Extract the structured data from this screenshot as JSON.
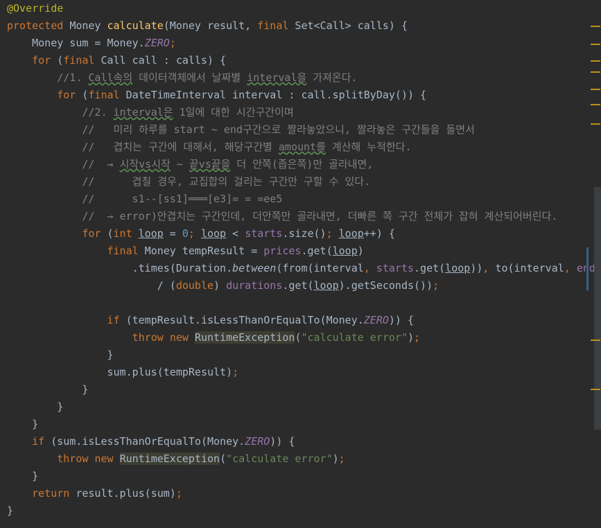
{
  "code": {
    "l01_annotation": "@Override",
    "l02_protected": "protected",
    "l02_type": "Money",
    "l02_method": "calculate",
    "l02_params_a": "(Money result, ",
    "l02_final": "final",
    "l02_params_b": " Set<Call> calls) {",
    "l03_a": "Money sum = Money.",
    "l03_zero": "ZERO",
    "l03_semi": ";",
    "l04_for": "for",
    "l04_a": " (",
    "l04_final": "final",
    "l04_b": " Call call : calls) {",
    "l05_comment_a": "//1. ",
    "l05_comment_b": "Call속의",
    "l05_comment_c": " 데이터객체에서 날짜별 ",
    "l05_comment_d": "interval을",
    "l05_comment_e": " 가져온다.",
    "l06_for": "for",
    "l06_a": " (",
    "l06_final": "final",
    "l06_b": " DateTimeInterval interval : call.splitByDay()) {",
    "l07_a": "//2. ",
    "l07_b": "interval은",
    "l07_c": " 1일에 대한 시간구간이며",
    "l08": "//   미리 하루를 start ~ end구간으로 짤라놓았으니, 짤라놓은 구간들을 돌면서",
    "l08_end": "end구간으로",
    "l09_a": "//   겹치는 구간에 대해서, 해당구간별 ",
    "l09_b": "amount를",
    "l09_c": " 계산해 누적한다.",
    "l10_a": "//  → ",
    "l10_b": "시작vs시작",
    "l10_c": " ~ ",
    "l10_d": "끝vs끝을",
    "l10_e": " 더 안쪽(좁은쪽)만 골라내면,",
    "l11": "//      겹칠 경우, 교집합의 걸리는 구간만 구할 수 있다.",
    "l12": "//      s1--[ss1]═══[e3]= = =ee5",
    "l13": "//  → error)안겹치는 구간인데, 더안쪽만 골라내면, 더빠른 쪽 구간 전체가 잡혀 계산되어버린다.",
    "l14_for": "for",
    "l14_a": " (",
    "l14_int": "int",
    "l14_loop1": "loop",
    "l14_eq": " = ",
    "l14_zero": "0",
    "l14_semi1": "; ",
    "l14_loop2": "loop",
    "l14_lt": " < ",
    "l14_starts": "starts",
    "l14_size": ".size()",
    "l14_semi2": "; ",
    "l14_loop3": "loop",
    "l14_inc": "++) {",
    "l15_final": "final",
    "l15_a": " Money tempResult = ",
    "l15_prices": "prices",
    "l15_b": ".get(",
    "l15_loop": "loop",
    "l15_c": ")",
    "l16_a": ".times(Duration.",
    "l16_between": "between",
    "l16_b": "(from(interval",
    "l16_comma1": ", ",
    "l16_starts": "starts",
    "l16_c": ".get(",
    "l16_loop": "loop",
    "l16_d": "))",
    "l16_comma2": ", ",
    "l16_e": "to(interval",
    "l16_comma3": ", ",
    "l16_ends": "ends",
    "l17_a": "/ (",
    "l17_double": "double",
    "l17_b": ") ",
    "l17_durations": "durations",
    "l17_c": ".get(",
    "l17_loop": "loop",
    "l17_d": ").getSeconds())",
    "l17_semi": ";",
    "l19_if": "if",
    "l19_a": " (tempResult.isLessThanOrEqualTo(Money.",
    "l19_zero": "ZERO",
    "l19_b": ")) {",
    "l20_throw": "throw",
    "l20_new": "new",
    "l20_exc": "RuntimeException",
    "l20_a": "(",
    "l20_str": "\"calculate error\"",
    "l20_b": ")",
    "l20_semi": ";",
    "l21": "}",
    "l22_a": "sum.plus(tempResult)",
    "l22_semi": ";",
    "l23": "}",
    "l24": "}",
    "l25": "}",
    "l26_if": "if",
    "l26_a": " (sum.isLessThanOrEqualTo(Money.",
    "l26_zero": "ZERO",
    "l26_b": ")) {",
    "l27_throw": "throw",
    "l27_new": "new",
    "l27_exc": "RuntimeException",
    "l27_a": "(",
    "l27_str": "\"calculate error\"",
    "l27_b": ")",
    "l27_semi": ";",
    "l28": "}",
    "l29_return": "return",
    "l29_a": " result.plus(sum)",
    "l29_semi": ";",
    "l30": "}"
  },
  "colors": {
    "background": "#2b2b2b",
    "keyword": "#cc7832",
    "annotation": "#bbb529",
    "method_decl": "#ffc66d",
    "field": "#9876aa",
    "number": "#6897bb",
    "string": "#6a8759",
    "comment": "#808080",
    "default_text": "#a9b7c6",
    "marker": "#be9117"
  }
}
